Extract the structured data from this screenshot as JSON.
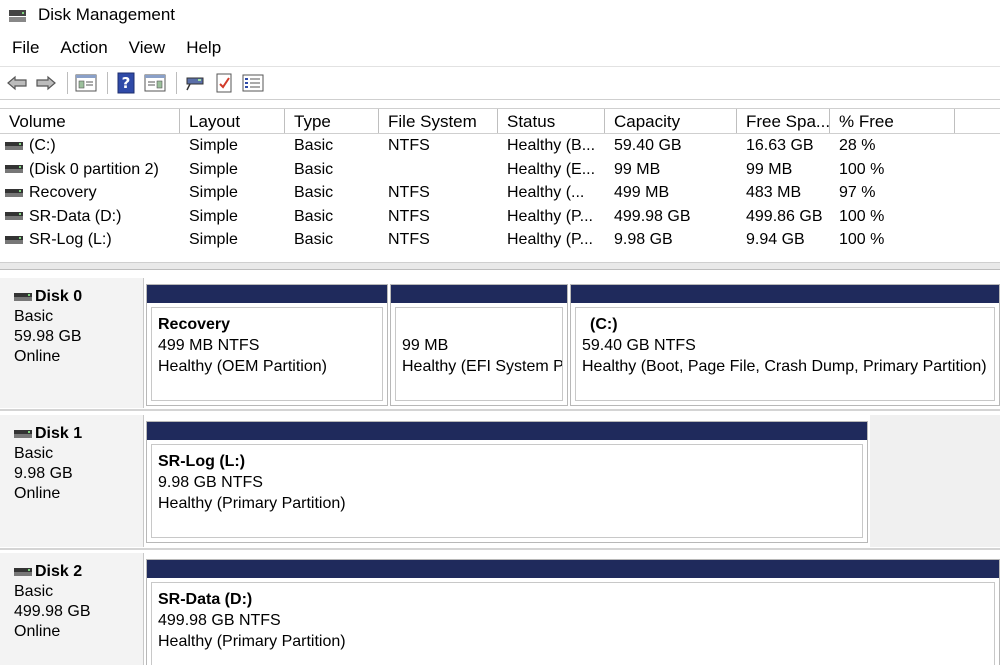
{
  "window": {
    "title": "Disk Management"
  },
  "menu": [
    "File",
    "Action",
    "View",
    "Help"
  ],
  "toolbar": {
    "icons": [
      "back-arrow-icon",
      "forward-arrow-icon",
      "console-tree-icon",
      "help-icon",
      "properties-pane-icon",
      "connect-icon",
      "checklist-icon",
      "list-view-icon"
    ]
  },
  "volume_list": {
    "columns": [
      "Volume",
      "Layout",
      "Type",
      "File System",
      "Status",
      "Capacity",
      "Free Spa...",
      "% Free"
    ],
    "rows": [
      [
        "(C:)",
        "Simple",
        "Basic",
        "NTFS",
        "Healthy (B...",
        "59.40 GB",
        "16.63 GB",
        "28 %"
      ],
      [
        "(Disk 0 partition 2)",
        "Simple",
        "Basic",
        "",
        "Healthy (E...",
        "99 MB",
        "99 MB",
        "100 %"
      ],
      [
        "Recovery",
        "Simple",
        "Basic",
        "NTFS",
        "Healthy (...",
        "499 MB",
        "483 MB",
        "97 %"
      ],
      [
        "SR-Data (D:)",
        "Simple",
        "Basic",
        "NTFS",
        "Healthy (P...",
        "499.98 GB",
        "499.86 GB",
        "100 %"
      ],
      [
        "SR-Log (L:)",
        "Simple",
        "Basic",
        "NTFS",
        "Healthy (P...",
        "9.98 GB",
        "9.94 GB",
        "100 %"
      ]
    ]
  },
  "disks": [
    {
      "name": "Disk 0",
      "type": "Basic",
      "size": "59.98 GB",
      "state": "Online",
      "partitions": [
        {
          "name": "Recovery",
          "size": "499 MB NTFS",
          "status": "Healthy (OEM Partition)"
        },
        {
          "name": "",
          "size": "99 MB",
          "status": "Healthy (EFI System P"
        },
        {
          "name": "(C:)",
          "size": "59.40 GB NTFS",
          "status": "Healthy (Boot, Page File, Crash Dump, Primary Partition)"
        }
      ]
    },
    {
      "name": "Disk 1",
      "type": "Basic",
      "size": "9.98 GB",
      "state": "Online",
      "partitions": [
        {
          "name": "SR-Log  (L:)",
          "size": "9.98 GB NTFS",
          "status": "Healthy (Primary Partition)"
        }
      ]
    },
    {
      "name": "Disk 2",
      "type": "Basic",
      "size": "499.98 GB",
      "state": "Online",
      "partitions": [
        {
          "name": "SR-Data  (D:)",
          "size": "499.98 GB NTFS",
          "status": "Healthy (Primary Partition)"
        }
      ]
    }
  ],
  "colors": {
    "partition_bar": "#1f2a5c",
    "label_bg": "#f3f3f3"
  }
}
